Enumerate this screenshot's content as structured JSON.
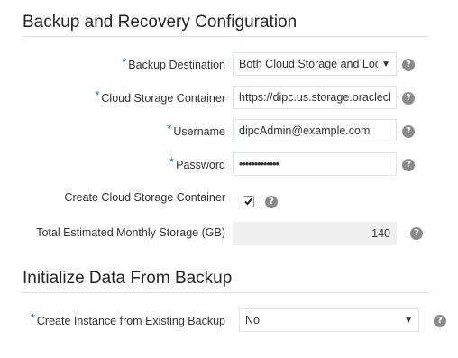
{
  "sections": {
    "backup": {
      "title": "Backup and Recovery Configuration"
    },
    "init": {
      "title": "Initialize Data From Backup"
    }
  },
  "fields": {
    "backup_destination": {
      "label": "Backup Destination",
      "value": "Both Cloud Storage and Local Storage",
      "required": "*"
    },
    "cloud_storage_container": {
      "label": "Cloud Storage Container",
      "value": "https://dipc.us.storage.oraclecloud.com",
      "required": "*"
    },
    "username": {
      "label": "Username",
      "value": "dipcAdmin@example.com",
      "required": "*"
    },
    "password": {
      "label": "Password",
      "value": "•••••••••••••",
      "required": "*"
    },
    "create_container": {
      "label": "Create Cloud Storage Container",
      "checked": true
    },
    "monthly_storage": {
      "label": "Total Estimated Monthly Storage (GB)",
      "value": "140"
    },
    "create_from_backup": {
      "label": "Create Instance from Existing Backup",
      "value": "No",
      "required": "*"
    }
  },
  "icons": {
    "help": "question-mark-help-icon",
    "dropdown": "caret-down-icon",
    "checkbox": "checkmark-icon"
  },
  "help_glyph": "?",
  "caret_glyph": "▼",
  "colors": {
    "required_asterisk": "#0b6eaf",
    "help_icon": "#8b8b8b",
    "readonly_field": "#efefef",
    "field_border": "#dfe4e7",
    "divider": "#dcdcdc"
  }
}
